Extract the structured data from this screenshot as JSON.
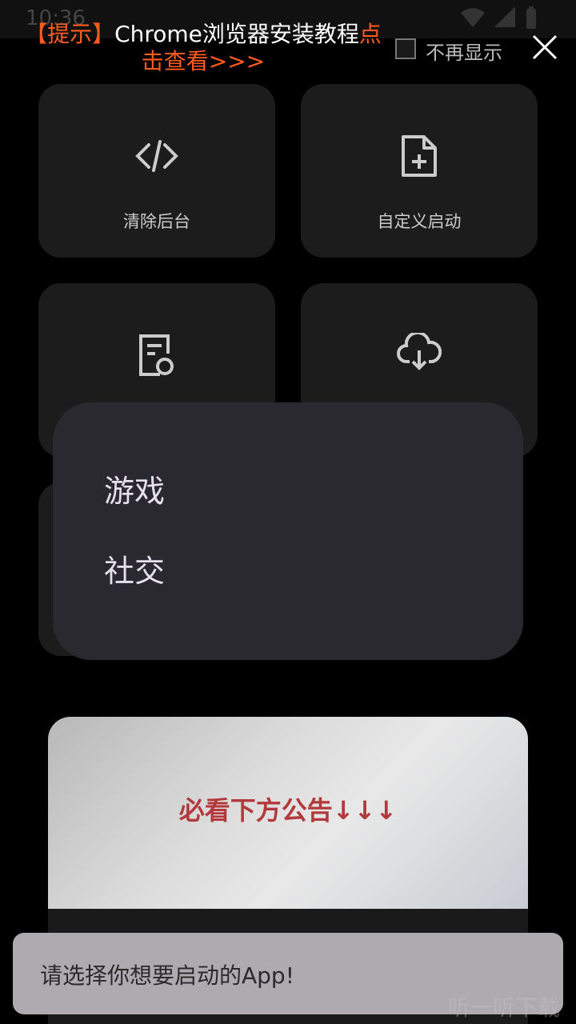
{
  "statusbar": {
    "time": "10:36"
  },
  "banner": {
    "prefix": "【提示】",
    "title": "Chrome浏览器安装教程",
    "link": "点击查看>>>",
    "no_more_label": "不再显示"
  },
  "tiles": [
    {
      "label": "清除后台",
      "icon": "code-icon"
    },
    {
      "label": "自定义启动",
      "icon": "file-plus-icon"
    },
    {
      "label": "",
      "icon": "document-sync-icon"
    },
    {
      "label": "",
      "icon": "cloud-download-icon"
    }
  ],
  "popup": {
    "items": [
      {
        "label": "游戏"
      },
      {
        "label": "社交"
      }
    ]
  },
  "ad_banner": {
    "text": "必看下方公告↓↓↓"
  },
  "toast": {
    "text": "请选择你想要启动的App!"
  },
  "watermark": {
    "text": "一听下载"
  },
  "colors": {
    "accent": "#ff5a1f",
    "popup_bg": "#2b2930",
    "tile_bg": "#1c1c1c"
  }
}
